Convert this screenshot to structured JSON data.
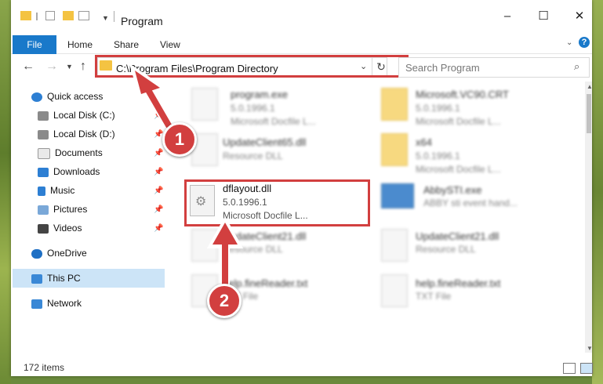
{
  "window": {
    "title": "Program",
    "minimize": "–",
    "maximize": "☐",
    "close": "✕"
  },
  "ribbon": {
    "tabs": [
      "File",
      "Home",
      "Share",
      "View"
    ],
    "help": "?"
  },
  "address_bar": {
    "path": "C:\\Program Files\\Program Directory"
  },
  "search": {
    "placeholder": "Search Program"
  },
  "nav": {
    "items": [
      {
        "label": "Quick access"
      },
      {
        "label": "Local Disk (C:)"
      },
      {
        "label": "Local Disk (D:)"
      },
      {
        "label": "Documents"
      },
      {
        "label": "Downloads"
      },
      {
        "label": "Music"
      },
      {
        "label": "Pictures"
      },
      {
        "label": "Videos"
      },
      {
        "label": "OneDrive"
      },
      {
        "label": "This PC"
      },
      {
        "label": "Network"
      }
    ]
  },
  "files": [
    {
      "name": "program.exe",
      "sub1": "5.0.1996.1",
      "sub2": "Microsoft Docfile L..."
    },
    {
      "name": "Microsoft.VC90.CRT",
      "sub1": "5.0.1996.1",
      "sub2": "Microsoft Docfile L..."
    },
    {
      "name": "UpdateClient65.dll",
      "sub1": "Resource DLL"
    },
    {
      "name": "x64",
      "sub1": "5.0.1996.1",
      "sub2": "Microsoft Docfile L..."
    },
    {
      "name": "dflayout.dll",
      "sub1": "5.0.1996.1",
      "sub2": "Microsoft Docfile L..."
    },
    {
      "name": "AbbySTI.exe",
      "sub1": "ABBY sti event hand..."
    },
    {
      "name": "UpdateClient21.dll",
      "sub1": "Resource DLL"
    },
    {
      "name": "UpdateClient21.dll",
      "sub1": "Resource DLL"
    },
    {
      "name": "help.fineReader.txt",
      "sub1": "TXT File"
    },
    {
      "name": "help.fineReader.txt",
      "sub1": "TXT File"
    }
  ],
  "status": {
    "items_count": "172 items"
  },
  "annotations": {
    "step1": "1",
    "step2": "2"
  },
  "colors": {
    "accent": "#1979ca",
    "highlight": "#d23f3f",
    "selection": "#cce4f7"
  }
}
